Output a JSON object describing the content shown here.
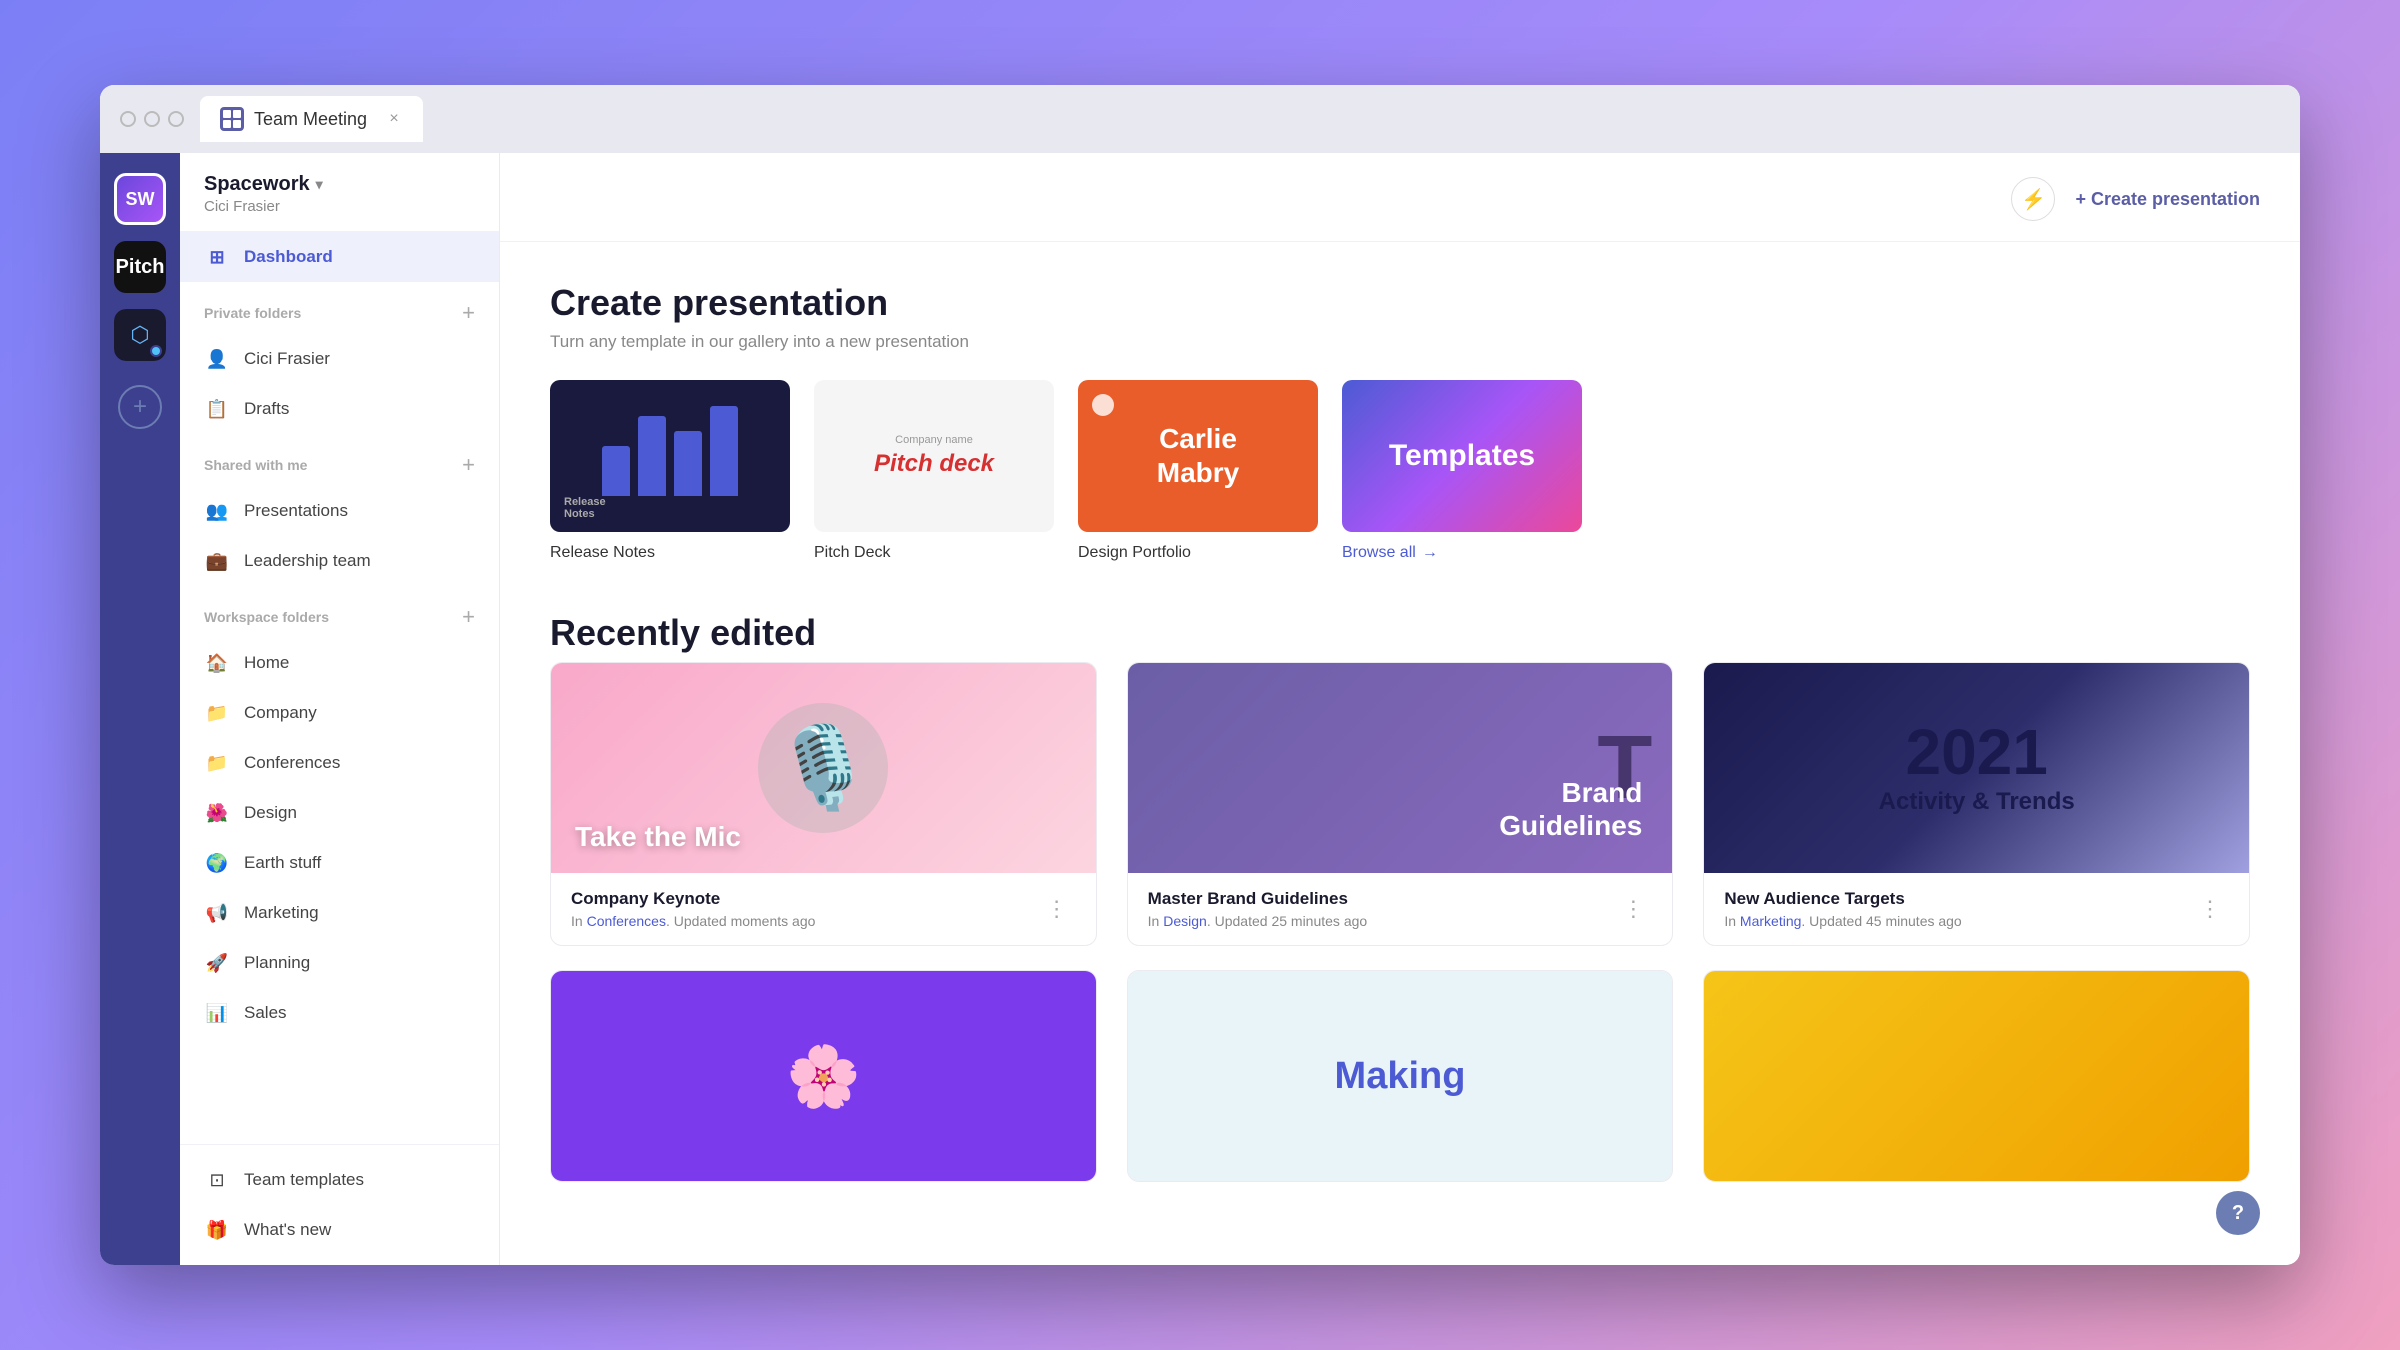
{
  "browser": {
    "tab_label": "Team Meeting",
    "close_label": "×"
  },
  "icon_bar": {
    "avatar_initials": "SW",
    "pitch_label": "Pitch",
    "add_label": "+"
  },
  "sidebar": {
    "workspace_name": "Spacework",
    "user_name": "Cici Frasier",
    "nav_dashboard": "Dashboard",
    "private_folders_label": "Private folders",
    "cici_frasier": "Cici Frasier",
    "drafts": "Drafts",
    "shared_with_me": "Shared with me",
    "presentations": "Presentations",
    "leadership_team": "Leadership team",
    "workspace_folders": "Workspace folders",
    "home": "Home",
    "company": "Company",
    "conferences": "Conferences",
    "design": "Design",
    "earth_stuff": "Earth stuff",
    "marketing": "Marketing",
    "planning": "Planning",
    "sales": "Sales",
    "team_templates": "Team templates",
    "whats_new": "What's new"
  },
  "topbar": {
    "create_label": "+ Create presentation"
  },
  "create_section": {
    "heading": "Create presentation",
    "subheading": "Turn any template in our gallery into a new presentation",
    "templates": [
      {
        "name": "Release Notes",
        "type": "release"
      },
      {
        "name": "Pitch Deck",
        "type": "pitch"
      },
      {
        "name": "Design Portfolio",
        "type": "design"
      },
      {
        "name": "Templates",
        "type": "browse"
      }
    ],
    "browse_all_label": "Browse all",
    "browse_all_arrow": "→"
  },
  "recently_edited": {
    "heading": "Recently edited",
    "cards": [
      {
        "title": "Company Keynote",
        "folder": "Conferences",
        "updated": "Updated moments ago",
        "overlay_text": "Take the Mic",
        "type": "keynote"
      },
      {
        "title": "Master Brand Guidelines",
        "folder": "Design",
        "updated": "Updated 25 minutes ago",
        "overlay_text": "Brand Guidelines",
        "type": "brand"
      },
      {
        "title": "New Audience Targets",
        "folder": "Marketing",
        "updated": "Updated 45 minutes ago",
        "overlay_text": "2021 Activity & Trends",
        "type": "audience"
      }
    ],
    "second_row_cards": [
      {
        "type": "purple",
        "text": ""
      },
      {
        "type": "light",
        "text": "Making"
      },
      {
        "type": "yellow",
        "text": ""
      }
    ]
  },
  "help": {
    "label": "?"
  }
}
